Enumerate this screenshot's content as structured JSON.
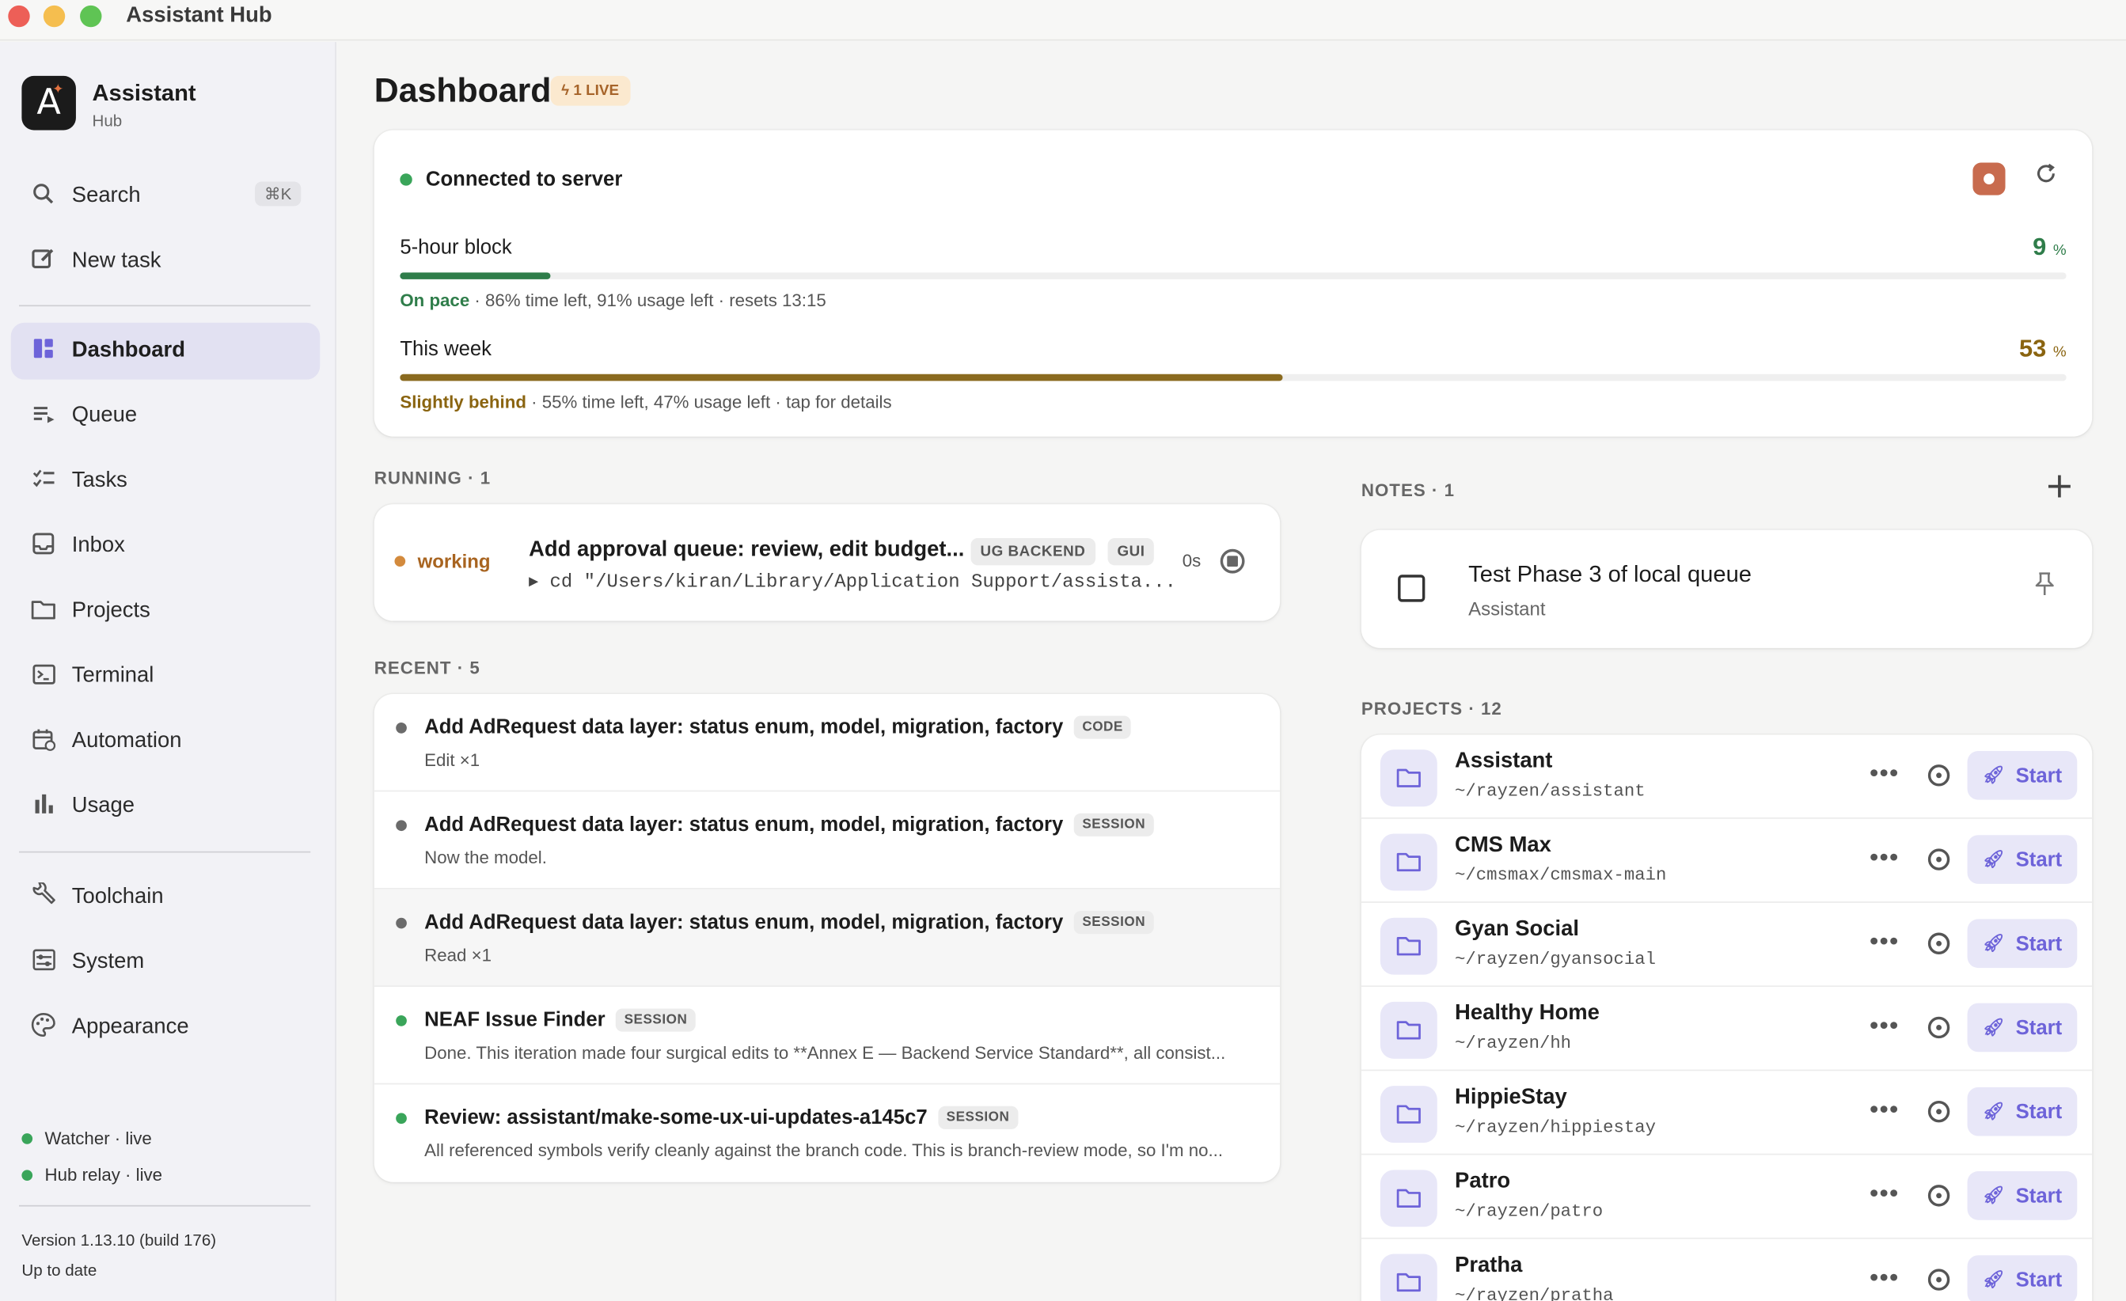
{
  "window": {
    "title": "Assistant Hub"
  },
  "brand": {
    "logo_letter": "A",
    "name": "Assistant",
    "sub": "Hub"
  },
  "sidebar": {
    "search": {
      "label": "Search",
      "shortcut": "⌘K"
    },
    "new_task": "New task",
    "items": [
      {
        "label": "Dashboard",
        "icon": "dashboard-icon"
      },
      {
        "label": "Queue",
        "icon": "queue-icon"
      },
      {
        "label": "Tasks",
        "icon": "tasks-icon"
      },
      {
        "label": "Inbox",
        "icon": "inbox-icon"
      },
      {
        "label": "Projects",
        "icon": "folder-icon"
      },
      {
        "label": "Terminal",
        "icon": "terminal-icon"
      },
      {
        "label": "Automation",
        "icon": "calendar-icon"
      },
      {
        "label": "Usage",
        "icon": "bar-chart-icon"
      }
    ],
    "items2": [
      {
        "label": "Toolchain",
        "icon": "wrench-icon"
      },
      {
        "label": "System",
        "icon": "sliders-icon"
      },
      {
        "label": "Appearance",
        "icon": "palette-icon"
      }
    ],
    "status": [
      "Watcher · live",
      "Hub relay · live"
    ],
    "version": "Version 1.13.10 (build 176)",
    "update_status": "Up to date"
  },
  "dashboard": {
    "title": "Dashboard",
    "live_badge": "1 LIVE",
    "connection": "Connected to server",
    "block": {
      "label": "5-hour block",
      "percent": "9",
      "unit": "%",
      "progress": 9,
      "status": "On pace",
      "detail": " · 86% time left, 91% usage left · resets 13:15"
    },
    "week": {
      "label": "This week",
      "percent": "53",
      "unit": "%",
      "progress": 53,
      "status": "Slightly behind",
      "detail": " · 55% time left, 47% usage left · tap for details"
    },
    "running_label": "RUNNING · 1",
    "running": {
      "state": "working",
      "title": "Add approval queue: review, edit budget...",
      "tags": [
        "UG BACKEND",
        "GUI"
      ],
      "command": "▸ cd \"/Users/kiran/Library/Application Support/assista...",
      "elapsed": "0s"
    },
    "recent_label": "RECENT · 5",
    "recent": [
      {
        "title": "Add AdRequest data layer: status enum, model, migration, factory",
        "tag": "CODE",
        "sub": "Edit ×1",
        "dot": "#6b6b6b"
      },
      {
        "title": "Add AdRequest data layer: status enum, model, migration, factory",
        "tag": "SESSION",
        "sub": "Now the model.",
        "dot": "#6b6b6b"
      },
      {
        "title": "Add AdRequest data layer: status enum, model, migration, factory",
        "tag": "SESSION",
        "sub": "Read ×1",
        "dot": "#6b6b6b"
      },
      {
        "title": "NEAF Issue Finder",
        "tag": "SESSION",
        "sub": "Done. This iteration made four surgical edits to **Annex E — Backend Service Standard**, all consist...",
        "dot": "#3aa55a"
      },
      {
        "title": "Review: assistant/make-some-ux-ui-updates-a145c7",
        "tag": "SESSION",
        "sub": "All referenced symbols verify cleanly against the branch code. This is branch-review mode, so I'm no...",
        "dot": "#3aa55a"
      }
    ],
    "notes_label": "NOTES · 1",
    "notes": [
      {
        "title": "Test Phase 3 of local queue",
        "sub": "Assistant"
      }
    ],
    "projects_label": "PROJECTS · 12",
    "start_label": "Start",
    "projects": [
      {
        "name": "Assistant",
        "path": "~/rayzen/assistant"
      },
      {
        "name": "CMS Max",
        "path": "~/cmsmax/cmsmax-main"
      },
      {
        "name": "Gyan Social",
        "path": "~/rayzen/gyansocial"
      },
      {
        "name": "Healthy Home",
        "path": "~/rayzen/hh"
      },
      {
        "name": "HippieStay",
        "path": "~/rayzen/hippiestay"
      },
      {
        "name": "Patro",
        "path": "~/rayzen/patro"
      },
      {
        "name": "Pratha",
        "path": "~/rayzen/pratha"
      }
    ]
  },
  "colors": {
    "accent": "#6d63d9",
    "good": "#2f7d4a",
    "warn": "#8a6410",
    "week_bar": "#8a6a1f",
    "block_bar": "#2f7d4a"
  }
}
